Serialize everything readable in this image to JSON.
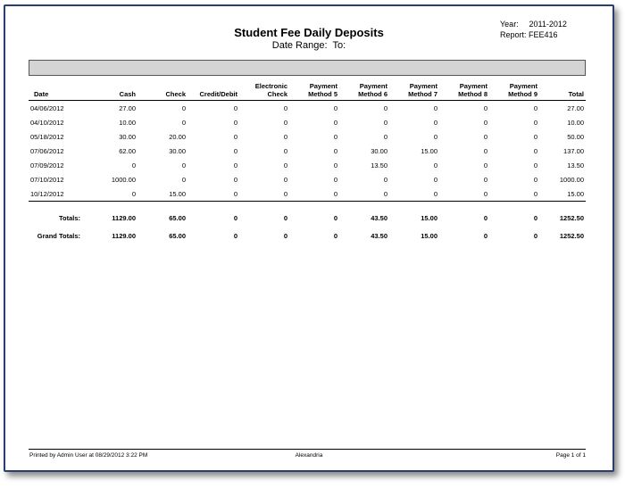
{
  "report": {
    "title": "Student Fee Daily Deposits",
    "date_range_label": "Date Range:",
    "date_to_label": "To:",
    "year_label": "Year:",
    "year_value": "2011-2012",
    "report_label": "Report:",
    "report_value": "FEE416"
  },
  "table": {
    "headers": {
      "date": "Date",
      "cash": "Cash",
      "check": "Check",
      "credit_debit": "Credit/Debit",
      "electronic_line1": "Electronic",
      "electronic_line2": "Check",
      "pm5_line1": "Payment",
      "pm5_line2": "Method 5",
      "pm6_line1": "Payment",
      "pm6_line2": "Method 6",
      "pm7_line1": "Payment",
      "pm7_line2": "Method 7",
      "pm8_line1": "Payment",
      "pm8_line2": "Method 8",
      "pm9_line1": "Payment",
      "pm9_line2": "Method 9",
      "total": "Total"
    },
    "rows": [
      [
        "04/06/2012",
        "27.00",
        "0",
        "0",
        "0",
        "0",
        "0",
        "0",
        "0",
        "0",
        "27.00"
      ],
      [
        "04/10/2012",
        "10.00",
        "0",
        "0",
        "0",
        "0",
        "0",
        "0",
        "0",
        "0",
        "10.00"
      ],
      [
        "05/18/2012",
        "30.00",
        "20.00",
        "0",
        "0",
        "0",
        "0",
        "0",
        "0",
        "0",
        "50.00"
      ],
      [
        "07/06/2012",
        "62.00",
        "30.00",
        "0",
        "0",
        "0",
        "30.00",
        "15.00",
        "0",
        "0",
        "137.00"
      ],
      [
        "07/09/2012",
        "0",
        "0",
        "0",
        "0",
        "0",
        "13.50",
        "0",
        "0",
        "0",
        "13.50"
      ],
      [
        "07/10/2012",
        "1000.00",
        "0",
        "0",
        "0",
        "0",
        "0",
        "0",
        "0",
        "0",
        "1000.00"
      ],
      [
        "10/12/2012",
        "0",
        "15.00",
        "0",
        "0",
        "0",
        "0",
        "0",
        "0",
        "0",
        "15.00"
      ]
    ],
    "totals": [
      "Totals:",
      "1129.00",
      "65.00",
      "0",
      "0",
      "0",
      "43.50",
      "15.00",
      "0",
      "0",
      "1252.50"
    ],
    "grand_totals": [
      "Grand Totals:",
      "1129.00",
      "65.00",
      "0",
      "0",
      "0",
      "43.50",
      "15.00",
      "0",
      "0",
      "1252.50"
    ]
  },
  "footer": {
    "printed_by": "Printed by Admin User at 08/29/2012 3:22 PM",
    "location": "Alexandria",
    "page": "Page 1 of 1"
  }
}
